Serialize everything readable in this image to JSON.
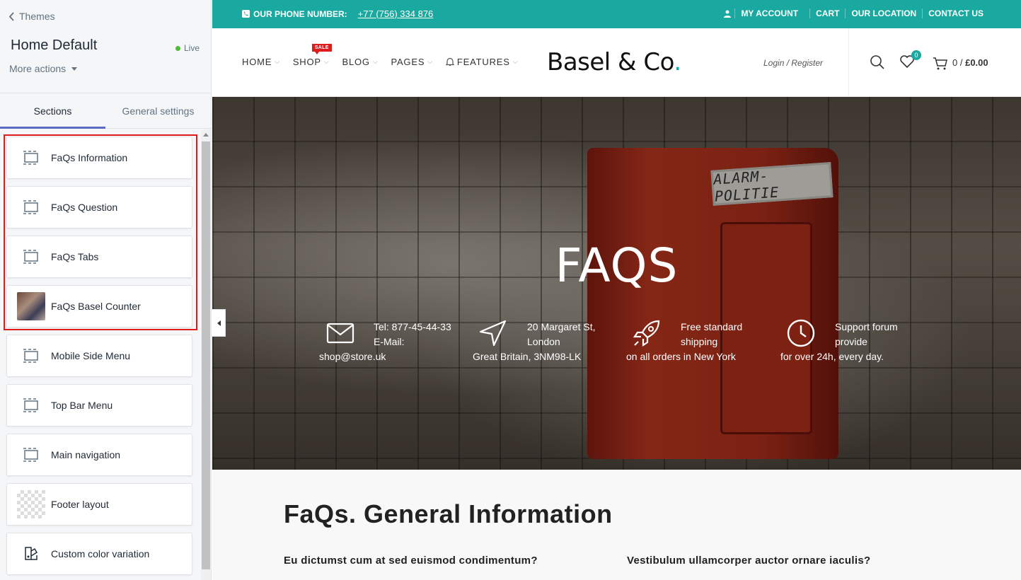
{
  "sidebar": {
    "back_label": "Themes",
    "theme_name": "Home Default",
    "status": "Live",
    "more_actions": "More actions",
    "tabs": [
      "Sections",
      "General settings"
    ],
    "sections": [
      {
        "label": "FaQs Information",
        "icon": "section-icon"
      },
      {
        "label": "FaQs Question",
        "icon": "section-icon"
      },
      {
        "label": "FaQs Tabs",
        "icon": "section-icon"
      },
      {
        "label": "FaQs Basel Counter",
        "icon": "image-thumbnail"
      },
      {
        "label": "Mobile Side Menu",
        "icon": "section-icon"
      },
      {
        "label": "Top Bar Menu",
        "icon": "section-icon"
      },
      {
        "label": "Main navigation",
        "icon": "section-icon"
      },
      {
        "label": "Footer layout",
        "icon": "transparent-thumbnail"
      },
      {
        "label": "Custom color variation",
        "icon": "color-palette-icon"
      }
    ]
  },
  "preview": {
    "topbar": {
      "phone_label": "OUR PHONE NUMBER:",
      "phone_number": "+77 (756) 334 876",
      "links": [
        "MY ACCOUNT",
        "CART",
        "OUR LOCATION",
        "CONTACT US"
      ]
    },
    "nav": [
      "HOME",
      "SHOP",
      "BLOG",
      "PAGES",
      "FEATURES"
    ],
    "sale_badge": "SALE",
    "logo_text": "Basel & Co",
    "logo_dot": ".",
    "login": "Login / Register",
    "wishlist_count": "0",
    "cart_count": "0 /",
    "cart_total": "£0.00",
    "hero": {
      "title": "FAQS",
      "info": [
        {
          "icon": "mail-icon",
          "line1": "Tel: 877-45-44-33",
          "line2": "E-Mail:",
          "line3": "shop@store.uk"
        },
        {
          "icon": "navigation-arrow-icon",
          "line1": "20 Margaret St,",
          "line2": "London",
          "line3": "Great Britain, 3NM98-LK"
        },
        {
          "icon": "rocket-icon",
          "line1": "Free standard",
          "line2": "shipping",
          "line3": "on all orders in New York"
        },
        {
          "icon": "clock-icon",
          "line1": "Support forum",
          "line2": "provide",
          "line3": "for over 24h, every day."
        }
      ],
      "box_label": "ALARM-POLITIE"
    },
    "faq_title": "FaQs. General Information",
    "questions": [
      "Eu dictumst cum at sed euismod condimentum?",
      "Vestibulum ullamcorper auctor ornare iaculis?"
    ]
  },
  "colors": {
    "accent": "#1aa9a0",
    "highlight": "#e01b1b",
    "tab_active": "#5c6ac4",
    "live": "#50b83c"
  }
}
